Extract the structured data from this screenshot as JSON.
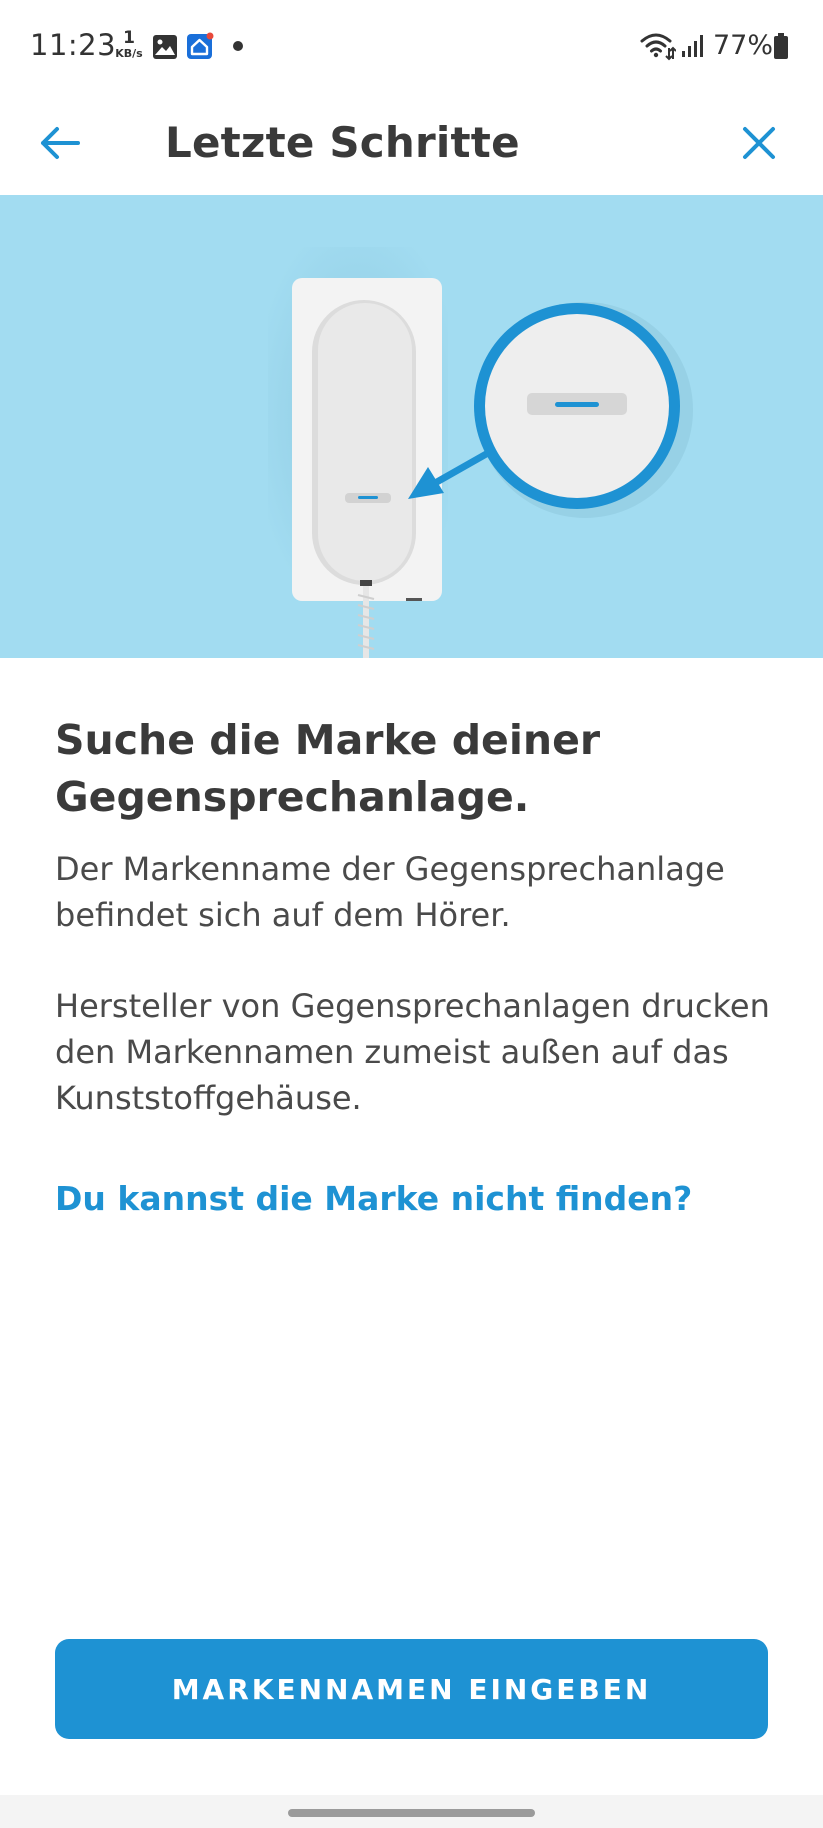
{
  "status_bar": {
    "time": "11:23",
    "net_speed_value": "1",
    "net_speed_unit": "KB/s",
    "battery": "77%"
  },
  "header": {
    "title": "Letzte Schritte",
    "back_icon": "arrow-left-icon",
    "close_icon": "close-icon"
  },
  "content": {
    "heading": "Suche die Marke deiner Gegensprechanlage.",
    "paragraph_1": "Der Markenname der Gegensprechanlage befindet sich auf dem Hörer.",
    "paragraph_2": "Hersteller von Gegensprechanlagen drucken den Markennamen zumeist außen auf das Kunststoffgehäuse.",
    "help_link": "Du kannst die Marke nicht finden?"
  },
  "actions": {
    "primary_label": "MARKENNAMEN EINGEBEN"
  },
  "colors": {
    "accent": "#1e92d3",
    "hero_background": "#a2dcf1",
    "text": "#3a3a3a"
  }
}
